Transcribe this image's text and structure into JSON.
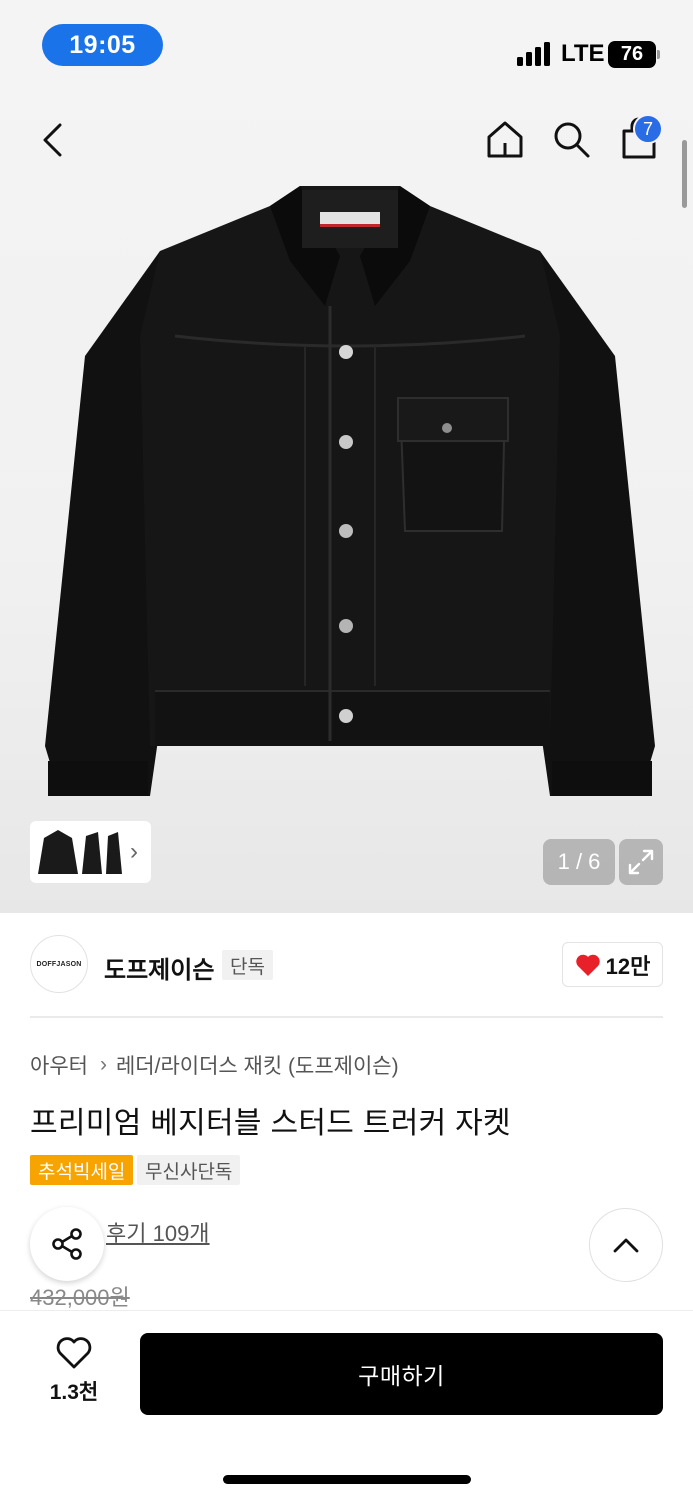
{
  "status_bar": {
    "time": "19:05",
    "network": "LTE",
    "battery": "76"
  },
  "nav": {
    "cart_count": "7"
  },
  "gallery": {
    "pager": "1 / 6"
  },
  "brand": {
    "logo_text": "DOFFJASON",
    "name": "도프제이슨",
    "tag": "단독",
    "likes": "12만"
  },
  "product": {
    "breadcrumb": [
      "아우터",
      "레더/라이더스 재킷 (도프제이슨)"
    ],
    "title": "프리미엄 베지터블 스터드 트러커 자켓",
    "tags": [
      "추석빅세일",
      "무신사단독"
    ],
    "reviews": "후기 109개",
    "original_price": "432,000원"
  },
  "bottom_bar": {
    "wish_count": "1.3천",
    "buy_label": "구매하기"
  },
  "colors": {
    "accent_blue": "#1a73e8",
    "badge_blue": "#2a6be6",
    "sale_orange": "#f7a300",
    "heart_red": "#e8202a",
    "buy_black": "#000000"
  }
}
